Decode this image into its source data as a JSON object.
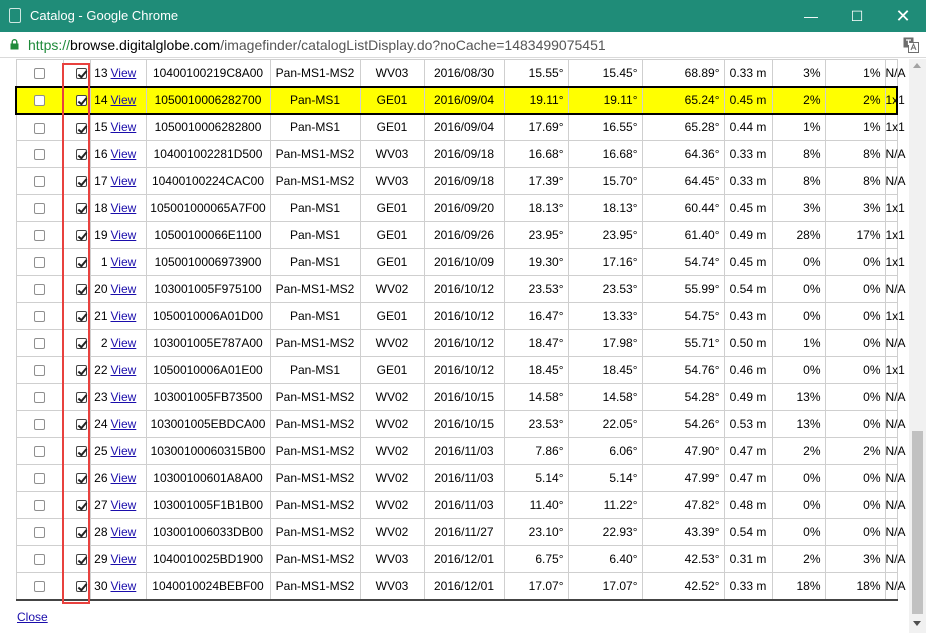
{
  "window": {
    "title": "Catalog - Google Chrome",
    "minimize_glyph": "—",
    "maximize_glyph": "☐",
    "close_glyph": "✕"
  },
  "address": {
    "scheme": "https://",
    "host": "browse.digitalglobe.com",
    "path": "/imagefinder/catalogListDisplay.do?noCache=1483499075451"
  },
  "icons": {
    "lock": "lock-icon",
    "translate": "translate-icon",
    "page": "page-icon"
  },
  "colors": {
    "titlebar": "#1f8c78",
    "highlight_row": "#ffff00",
    "selection_box": "#e8413e",
    "link": "#1a0dab",
    "secure": "#1e8a3a"
  },
  "table": {
    "link_label": "View",
    "rows": [
      {
        "num": "13",
        "checked": false,
        "selected": true,
        "catalog_id": "10400100219C8A00",
        "bands": "Pan-MS1-MS2",
        "sensor": "WV03",
        "date": "2016/08/30",
        "off_nadir": "15.55°",
        "target_az": "15.45°",
        "sun_elev": "68.89°",
        "res": "0.33 m",
        "cloud": "3%",
        "cloud_aoi": "1%",
        "stereo": "N/A",
        "highlight": false
      },
      {
        "num": "14",
        "checked": false,
        "selected": true,
        "catalog_id": "1050010006282700",
        "bands": "Pan-MS1",
        "sensor": "GE01",
        "date": "2016/09/04",
        "off_nadir": "19.11°",
        "target_az": "19.11°",
        "sun_elev": "65.24°",
        "res": "0.45 m",
        "cloud": "2%",
        "cloud_aoi": "2%",
        "stereo": "1x1",
        "highlight": true
      },
      {
        "num": "15",
        "checked": false,
        "selected": true,
        "catalog_id": "1050010006282800",
        "bands": "Pan-MS1",
        "sensor": "GE01",
        "date": "2016/09/04",
        "off_nadir": "17.69°",
        "target_az": "16.55°",
        "sun_elev": "65.28°",
        "res": "0.44 m",
        "cloud": "1%",
        "cloud_aoi": "1%",
        "stereo": "1x1",
        "highlight": false
      },
      {
        "num": "16",
        "checked": false,
        "selected": true,
        "catalog_id": "104001002281D500",
        "bands": "Pan-MS1-MS2",
        "sensor": "WV03",
        "date": "2016/09/18",
        "off_nadir": "16.68°",
        "target_az": "16.68°",
        "sun_elev": "64.36°",
        "res": "0.33 m",
        "cloud": "8%",
        "cloud_aoi": "8%",
        "stereo": "N/A",
        "highlight": false
      },
      {
        "num": "17",
        "checked": false,
        "selected": true,
        "catalog_id": "10400100224CAC00",
        "bands": "Pan-MS1-MS2",
        "sensor": "WV03",
        "date": "2016/09/18",
        "off_nadir": "17.39°",
        "target_az": "15.70°",
        "sun_elev": "64.45°",
        "res": "0.33 m",
        "cloud": "8%",
        "cloud_aoi": "8%",
        "stereo": "N/A",
        "highlight": false
      },
      {
        "num": "18",
        "checked": false,
        "selected": true,
        "catalog_id": "105001000065A7F00",
        "bands": "Pan-MS1",
        "sensor": "GE01",
        "date": "2016/09/20",
        "off_nadir": "18.13°",
        "target_az": "18.13°",
        "sun_elev": "60.44°",
        "res": "0.45 m",
        "cloud": "3%",
        "cloud_aoi": "3%",
        "stereo": "1x1",
        "highlight": false
      },
      {
        "num": "19",
        "checked": false,
        "selected": true,
        "catalog_id": "10500100066E1100",
        "bands": "Pan-MS1",
        "sensor": "GE01",
        "date": "2016/09/26",
        "off_nadir": "23.95°",
        "target_az": "23.95°",
        "sun_elev": "61.40°",
        "res": "0.49 m",
        "cloud": "28%",
        "cloud_aoi": "17%",
        "stereo": "1x1",
        "highlight": false
      },
      {
        "num": "1",
        "checked": false,
        "selected": true,
        "catalog_id": "1050010006973900",
        "bands": "Pan-MS1",
        "sensor": "GE01",
        "date": "2016/10/09",
        "off_nadir": "19.30°",
        "target_az": "17.16°",
        "sun_elev": "54.74°",
        "res": "0.45 m",
        "cloud": "0%",
        "cloud_aoi": "0%",
        "stereo": "1x1",
        "highlight": false
      },
      {
        "num": "20",
        "checked": false,
        "selected": true,
        "catalog_id": "103001005F975100",
        "bands": "Pan-MS1-MS2",
        "sensor": "WV02",
        "date": "2016/10/12",
        "off_nadir": "23.53°",
        "target_az": "23.53°",
        "sun_elev": "55.99°",
        "res": "0.54 m",
        "cloud": "0%",
        "cloud_aoi": "0%",
        "stereo": "N/A",
        "highlight": false
      },
      {
        "num": "21",
        "checked": false,
        "selected": true,
        "catalog_id": "1050010006A01D00",
        "bands": "Pan-MS1",
        "sensor": "GE01",
        "date": "2016/10/12",
        "off_nadir": "16.47°",
        "target_az": "13.33°",
        "sun_elev": "54.75°",
        "res": "0.43 m",
        "cloud": "0%",
        "cloud_aoi": "0%",
        "stereo": "1x1",
        "highlight": false
      },
      {
        "num": "2",
        "checked": false,
        "selected": true,
        "catalog_id": "103001005E787A00",
        "bands": "Pan-MS1-MS2",
        "sensor": "WV02",
        "date": "2016/10/12",
        "off_nadir": "18.47°",
        "target_az": "17.98°",
        "sun_elev": "55.71°",
        "res": "0.50 m",
        "cloud": "1%",
        "cloud_aoi": "0%",
        "stereo": "N/A",
        "highlight": false
      },
      {
        "num": "22",
        "checked": false,
        "selected": true,
        "catalog_id": "1050010006A01E00",
        "bands": "Pan-MS1",
        "sensor": "GE01",
        "date": "2016/10/12",
        "off_nadir": "18.45°",
        "target_az": "18.45°",
        "sun_elev": "54.76°",
        "res": "0.46 m",
        "cloud": "0%",
        "cloud_aoi": "0%",
        "stereo": "1x1",
        "highlight": false
      },
      {
        "num": "23",
        "checked": false,
        "selected": true,
        "catalog_id": "103001005FB73500",
        "bands": "Pan-MS1-MS2",
        "sensor": "WV02",
        "date": "2016/10/15",
        "off_nadir": "14.58°",
        "target_az": "14.58°",
        "sun_elev": "54.28°",
        "res": "0.49 m",
        "cloud": "13%",
        "cloud_aoi": "0%",
        "stereo": "N/A",
        "highlight": false
      },
      {
        "num": "24",
        "checked": false,
        "selected": true,
        "catalog_id": "103001005EBDCA00",
        "bands": "Pan-MS1-MS2",
        "sensor": "WV02",
        "date": "2016/10/15",
        "off_nadir": "23.53°",
        "target_az": "22.05°",
        "sun_elev": "54.26°",
        "res": "0.53 m",
        "cloud": "13%",
        "cloud_aoi": "0%",
        "stereo": "N/A",
        "highlight": false
      },
      {
        "num": "25",
        "checked": false,
        "selected": true,
        "catalog_id": "10300100060315B00",
        "bands": "Pan-MS1-MS2",
        "sensor": "WV02",
        "date": "2016/11/03",
        "off_nadir": "7.86°",
        "target_az": "6.06°",
        "sun_elev": "47.90°",
        "res": "0.47 m",
        "cloud": "2%",
        "cloud_aoi": "2%",
        "stereo": "N/A",
        "highlight": false
      },
      {
        "num": "26",
        "checked": false,
        "selected": true,
        "catalog_id": "10300100601A8A00",
        "bands": "Pan-MS1-MS2",
        "sensor": "WV02",
        "date": "2016/11/03",
        "off_nadir": "5.14°",
        "target_az": "5.14°",
        "sun_elev": "47.99°",
        "res": "0.47 m",
        "cloud": "0%",
        "cloud_aoi": "0%",
        "stereo": "N/A",
        "highlight": false
      },
      {
        "num": "27",
        "checked": false,
        "selected": true,
        "catalog_id": "103001005F1B1B00",
        "bands": "Pan-MS1-MS2",
        "sensor": "WV02",
        "date": "2016/11/03",
        "off_nadir": "11.40°",
        "target_az": "11.22°",
        "sun_elev": "47.82°",
        "res": "0.48 m",
        "cloud": "0%",
        "cloud_aoi": "0%",
        "stereo": "N/A",
        "highlight": false
      },
      {
        "num": "28",
        "checked": false,
        "selected": true,
        "catalog_id": "103001006033DB00",
        "bands": "Pan-MS1-MS2",
        "sensor": "WV02",
        "date": "2016/11/27",
        "off_nadir": "23.10°",
        "target_az": "22.93°",
        "sun_elev": "43.39°",
        "res": "0.54 m",
        "cloud": "0%",
        "cloud_aoi": "0%",
        "stereo": "N/A",
        "highlight": false
      },
      {
        "num": "29",
        "checked": false,
        "selected": true,
        "catalog_id": "1040010025BD1900",
        "bands": "Pan-MS1-MS2",
        "sensor": "WV03",
        "date": "2016/12/01",
        "off_nadir": "6.75°",
        "target_az": "6.40°",
        "sun_elev": "42.53°",
        "res": "0.31 m",
        "cloud": "2%",
        "cloud_aoi": "3%",
        "stereo": "N/A",
        "highlight": false
      },
      {
        "num": "30",
        "checked": false,
        "selected": true,
        "catalog_id": "1040010024BEBF00",
        "bands": "Pan-MS1-MS2",
        "sensor": "WV03",
        "date": "2016/12/01",
        "off_nadir": "17.07°",
        "target_az": "17.07°",
        "sun_elev": "42.52°",
        "res": "0.33 m",
        "cloud": "18%",
        "cloud_aoi": "18%",
        "stereo": "N/A",
        "highlight": false
      }
    ]
  },
  "footer": {
    "close_label": "Close"
  }
}
